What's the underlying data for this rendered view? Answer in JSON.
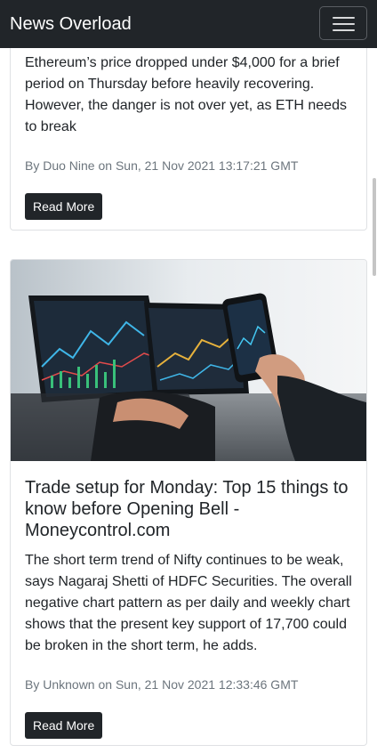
{
  "navbar": {
    "brand": "News Overload"
  },
  "articles": [
    {
      "description": "Ethereum’s price dropped under $4,000 for a brief period on Thursday before heavily recovering. However, the danger is not over yet, as ETH needs to break",
      "meta": "By Duo Nine on Sun, 21 Nov 2021 13:17:21 GMT",
      "button": "Read More"
    },
    {
      "title": "Trade setup for Monday: Top 15 things to know before Opening Bell - Moneycontrol.com",
      "description": "The short term trend of Nifty continues to be weak, says Nagaraj Shetti of HDFC Securities. The overall negative chart pattern as per daily and weekly chart shows that the present key support of 17,700 could be broken in the short term, he adds.",
      "meta": "By Unknown on Sun, 21 Nov 2021 12:33:46 GMT",
      "button": "Read More"
    }
  ]
}
